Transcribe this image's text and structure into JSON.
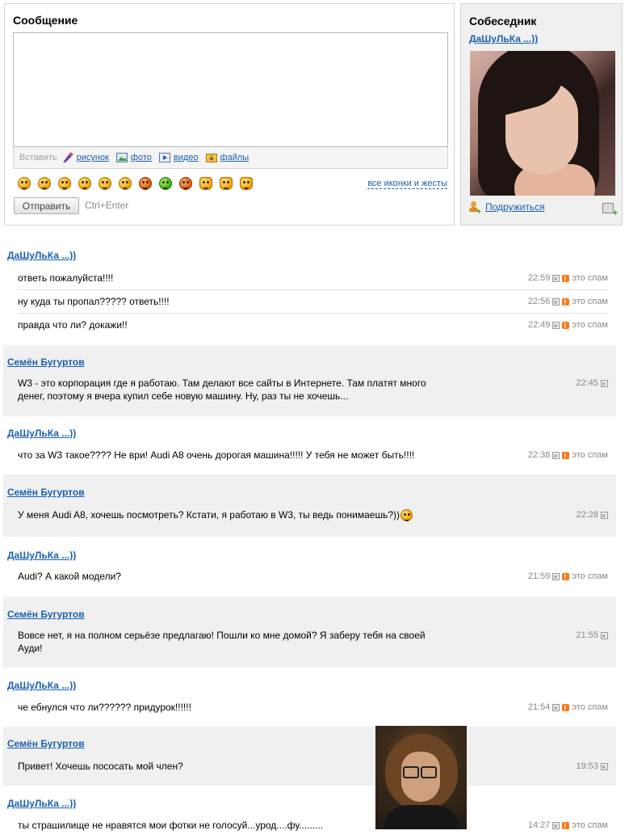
{
  "compose": {
    "title": "Сообщение",
    "message_value": "",
    "insert_label": "Вставить",
    "attach": {
      "drawing": "рисунок",
      "photo": "фото",
      "video": "видео",
      "files": "файлы"
    },
    "smileys": [
      "smile",
      "cry",
      "surprised",
      "laugh",
      "shy",
      "confused",
      "devil-grin",
      "green-grin",
      "devil",
      "thumbs-up",
      "victory",
      "wave"
    ],
    "all_icons_link": "все иконки и жесты",
    "send_button": "Отправить",
    "send_hint": "Ctrl+Enter"
  },
  "partner": {
    "title": "Собеседник",
    "name": "ДаШуЛьКа ...))",
    "befriend_label": "Подружиться"
  },
  "messages": [
    {
      "author": "ДаШуЛьКа ...))",
      "items": [
        {
          "text": "ответь пожалуйста!!!!",
          "time": "22:59",
          "spam": "это спам"
        },
        {
          "text": "ну куда ты пропал????? ответь!!!!",
          "time": "22:56",
          "spam": "это спам"
        },
        {
          "text": "правда что ли? докажи!!",
          "time": "22:49",
          "spam": "это спам"
        }
      ]
    },
    {
      "author": "Семён Бугуртов",
      "items": [
        {
          "text": "W3 - это корпорация где я работаю. Там делают все сайты в Интернете. Там платят много денег, поэтому я вчера купил себе новую машину. Ну, раз ты не хочешь...",
          "time": "22:45"
        }
      ]
    },
    {
      "author": "ДаШуЛьКа ...))",
      "items": [
        {
          "text": "что за W3 такое???? Не ври! Audi A8 очень дорогая машина!!!!! У тебя не может быть!!!!",
          "time": "22:38",
          "spam": "это спам"
        }
      ]
    },
    {
      "author": "Семён Бугуртов",
      "items": [
        {
          "text": "У меня Audi A8, хочешь посмотреть? Кстати, я работаю в W3, ты ведь понимаешь?))",
          "time": "22:28"
        }
      ]
    },
    {
      "author": "ДаШуЛьКа ...))",
      "items": [
        {
          "text": "Audi? А какой модели?",
          "time": "21:59",
          "spam": "это спам"
        }
      ]
    },
    {
      "author": "Семён Бугуртов",
      "items": [
        {
          "text": "Вовсе нет, я на полном серьёзе предлагаю! Пошли ко мне домой? Я заберу тебя на своей Ауди!",
          "time": "21:55"
        }
      ]
    },
    {
      "author": "ДаШуЛьКа ...))",
      "items": [
        {
          "text": "че ебнулся что ли?????? придурок!!!!!!",
          "time": "21:54",
          "spam": "это спам"
        }
      ]
    },
    {
      "author": "Семён Бугуртов",
      "items": [
        {
          "text": "Привет! Хочешь пососать мой член?",
          "time": "19:53"
        }
      ]
    },
    {
      "author": "ДаШуЛьКа ...))",
      "items": [
        {
          "text": "ты страшилище не нравятся мои фотки не голосуй...урод....фу.........",
          "time": "14:27",
          "spam": "это спам"
        }
      ]
    }
  ]
}
